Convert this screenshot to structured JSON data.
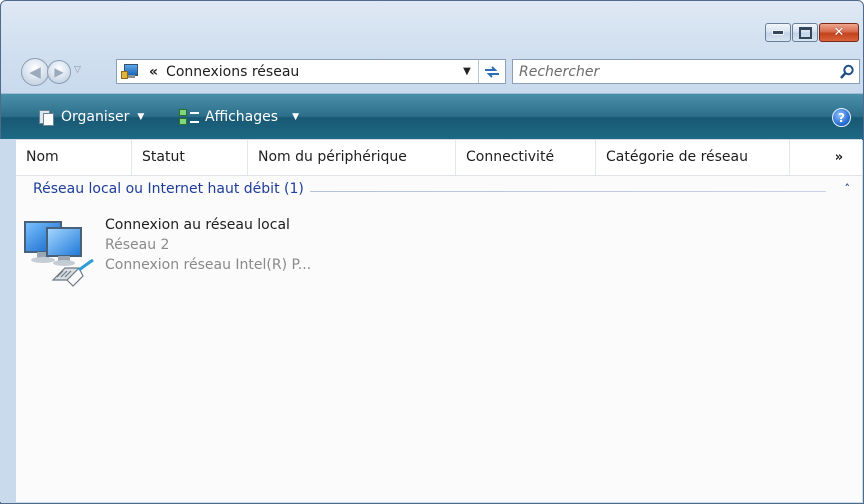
{
  "window": {
    "title_buttons": {
      "minimize": "minimize-icon",
      "maximize": "maximize-icon",
      "close": "close-icon"
    }
  },
  "navigation": {
    "address": {
      "chevron": "«",
      "text": "Connexions réseau"
    },
    "search": {
      "placeholder": "Rechercher"
    }
  },
  "command_bar": {
    "organize_label": "Organiser",
    "views_label": "Affichages"
  },
  "columns": [
    "Nom",
    "Statut",
    "Nom du périphérique",
    "Connectivité",
    "Catégorie de réseau"
  ],
  "columns_more": "»",
  "group": {
    "title": "Réseau local ou Internet haut débit (1)",
    "collapse": "˄"
  },
  "item": {
    "name": "Connexion au réseau local",
    "network": "Réseau  2",
    "device": "Connexion réseau Intel(R) P..."
  },
  "colors": {
    "command_bar": "#1e6a86",
    "group_title": "#1e3d9a",
    "frame": "#c9daed"
  }
}
